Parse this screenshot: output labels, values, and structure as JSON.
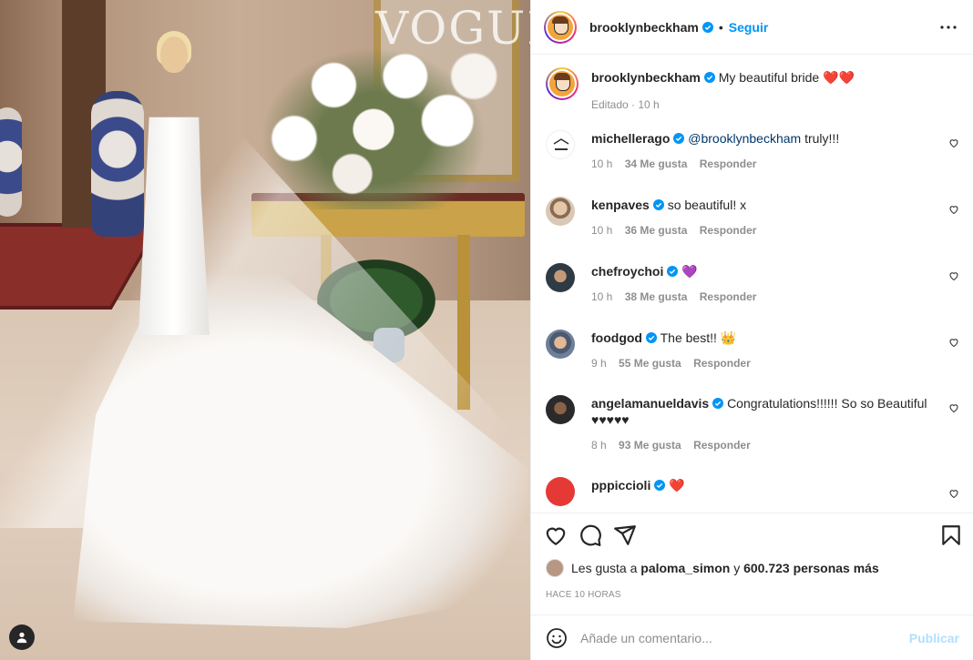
{
  "photo": {
    "watermark": "VOGUE"
  },
  "header": {
    "username": "brooklynbeckham",
    "separator": "•",
    "follow_label": "Seguir",
    "more_icon": "more-horizontal-icon"
  },
  "caption": {
    "username": "brooklynbeckham",
    "text": "My beautiful bride",
    "emoji": "❤️❤️",
    "edited": "Editado · 10 h"
  },
  "comments": [
    {
      "username": "michellerago",
      "mention": "@brooklynbeckham",
      "text": " truly!!!",
      "time": "10 h",
      "likes": "34 Me gusta",
      "reply": "Responder",
      "avatar_color": "#ffffff"
    },
    {
      "username": "kenpaves",
      "mention": "",
      "text": "so beautiful! x",
      "time": "10 h",
      "likes": "36 Me gusta",
      "reply": "Responder",
      "avatar_color": "#d9c8b5"
    },
    {
      "username": "chefroychoi",
      "mention": "",
      "text": "💜",
      "time": "10 h",
      "likes": "38 Me gusta",
      "reply": "Responder",
      "avatar_color": "#2e3b44"
    },
    {
      "username": "foodgod",
      "mention": "",
      "text": "The best!! 👑",
      "time": "9 h",
      "likes": "55 Me gusta",
      "reply": "Responder",
      "avatar_color": "#6e7f9a"
    },
    {
      "username": "angelamanueldavis",
      "mention": "",
      "text": "Congratulations!!!!!! So so Beautiful ♥♥♥♥♥",
      "time": "8 h",
      "likes": "93 Me gusta",
      "reply": "Responder",
      "avatar_color": "#2a2a2a"
    },
    {
      "username": "pppiccioli",
      "mention": "",
      "text": "❤️",
      "time": "",
      "likes": "",
      "reply": "",
      "avatar_color": "#e53935"
    }
  ],
  "likes": {
    "prefix": "Les gusta a",
    "user": "paloma_simon",
    "connector": "y",
    "count": "600.723 personas más"
  },
  "time_ago": "HACE 10 HORAS",
  "add_comment": {
    "placeholder": "Añade un comentario...",
    "post_label": "Publicar"
  },
  "colors": {
    "accent": "#0095f6",
    "text": "#262626",
    "muted": "#8e8e8e",
    "verified": "#0095f6"
  }
}
